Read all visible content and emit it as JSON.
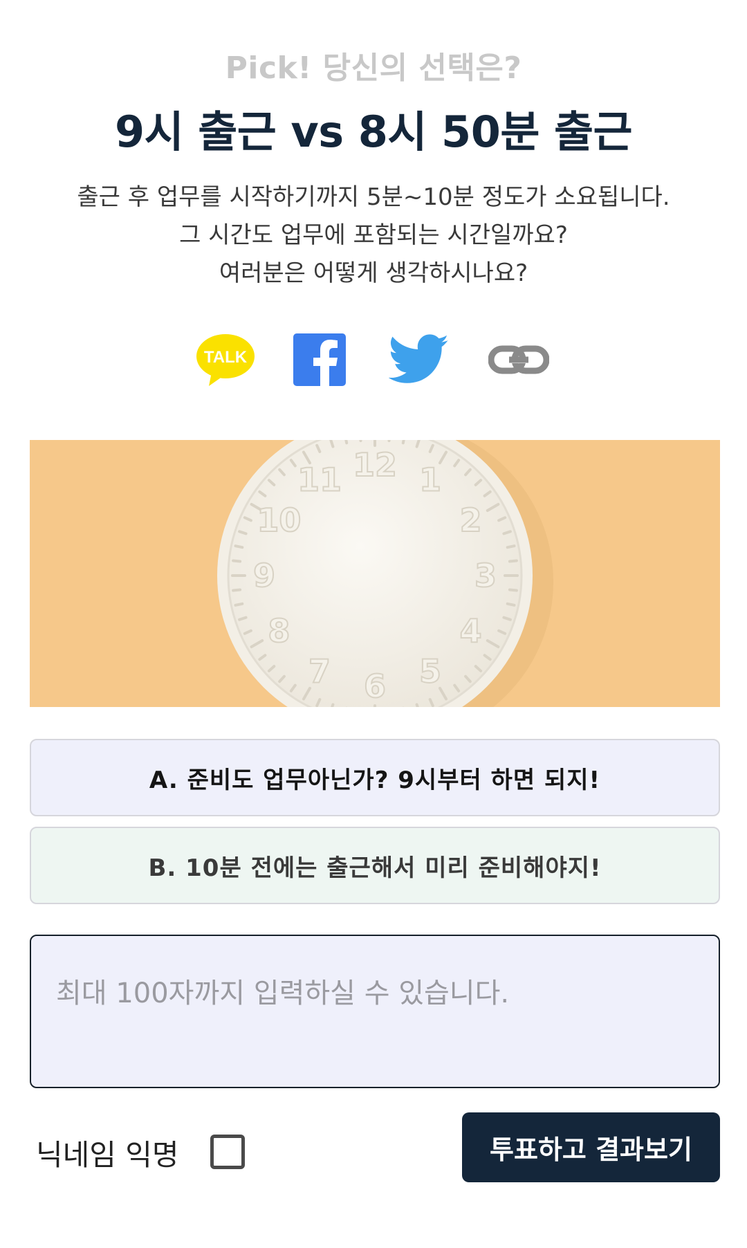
{
  "header": {
    "kicker": "Pick! 당신의 선택은?",
    "title": "9시 출근 vs 8시 50분 출근"
  },
  "description": [
    "출근 후 업무를 시작하기까지 5분~10분 정도가 소요됩니다.",
    "그 시간도 업무에 포함되는 시간일까요?",
    "여러분은 어떻게 생각하시나요?"
  ],
  "share": {
    "kakao": {
      "badge": "TALK",
      "icon": "kakaotalk-icon",
      "color": "#fae100"
    },
    "facebook": {
      "icon": "facebook-icon",
      "color": "#3b7ded"
    },
    "twitter": {
      "icon": "twitter-icon",
      "color": "#3ea1ec"
    },
    "link": {
      "icon": "link-icon",
      "color": "#8a8a8a"
    }
  },
  "hero": {
    "clock_numbers": [
      "12",
      "1",
      "2",
      "3",
      "4",
      "5",
      "6",
      "7",
      "8",
      "9",
      "10",
      "11"
    ],
    "background_color": "#f6c88a"
  },
  "options": [
    {
      "label": "A. 준비도 업무아닌가? 9시부터 하면 되지!",
      "color": "#eff0fb"
    },
    {
      "label": "B. 10분 전에는 출근해서 미리 준비해야지!",
      "color": "#eef6f2"
    }
  ],
  "comment": {
    "placeholder": "최대 100자까지 입력하실 수 있습니다.",
    "value": ""
  },
  "anonymous": {
    "label": "닉네임 익명",
    "checked": false
  },
  "submit": {
    "label": "투표하고 결과보기",
    "color": "#14263a"
  }
}
